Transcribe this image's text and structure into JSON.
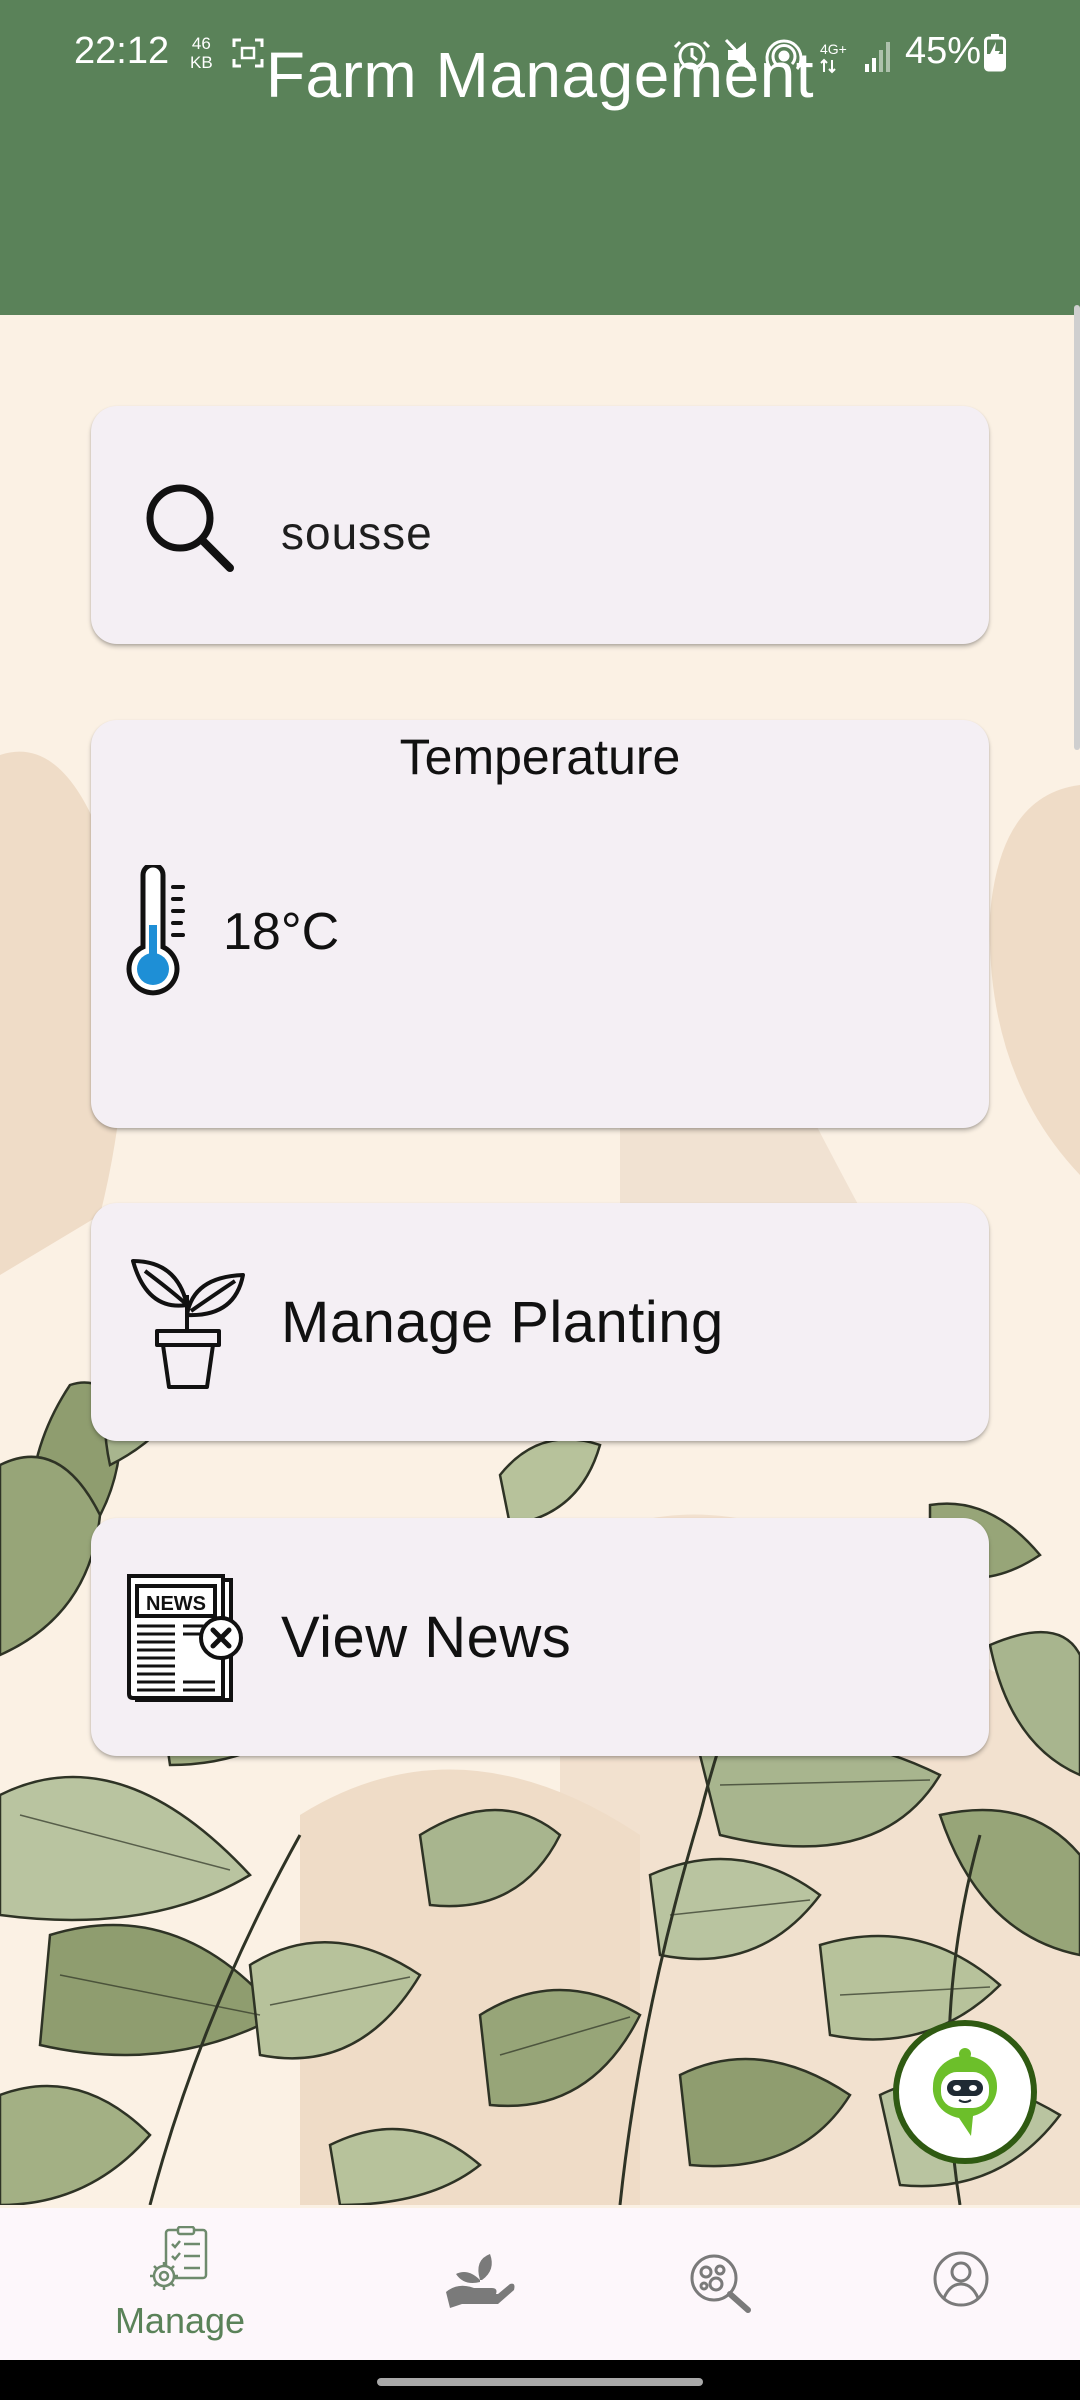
{
  "status_bar": {
    "time": "22:12",
    "data_rate_top": "46",
    "data_rate_unit": "KB",
    "network": "4G+",
    "battery": "45%"
  },
  "app_bar": {
    "title": "Farm Management"
  },
  "search": {
    "value": "sousse",
    "icon": "search-icon"
  },
  "temperature": {
    "title": "Temperature",
    "value": "18°C",
    "icon": "thermometer-icon"
  },
  "actions": {
    "manage_planting": {
      "label": "Manage Planting",
      "icon": "plant-pot-icon"
    },
    "view_news": {
      "label": "View News",
      "icon": "newspaper-icon",
      "icon_text": "NEWS"
    }
  },
  "chatbot": {
    "icon": "chatbot-icon"
  },
  "bottom_nav": {
    "items": [
      {
        "label": "Manage",
        "icon": "manage-icon",
        "active": true
      },
      {
        "label": "",
        "icon": "plant-hand-icon",
        "active": false
      },
      {
        "label": "",
        "icon": "disease-scan-icon",
        "active": false
      },
      {
        "label": "",
        "icon": "profile-icon",
        "active": false
      }
    ]
  },
  "colors": {
    "primary": "#5a8259",
    "background": "#fbf1e4",
    "card": "#f4eff4",
    "accent_green": "#6cbf2a",
    "thermometer_blue": "#1e8fd6"
  }
}
